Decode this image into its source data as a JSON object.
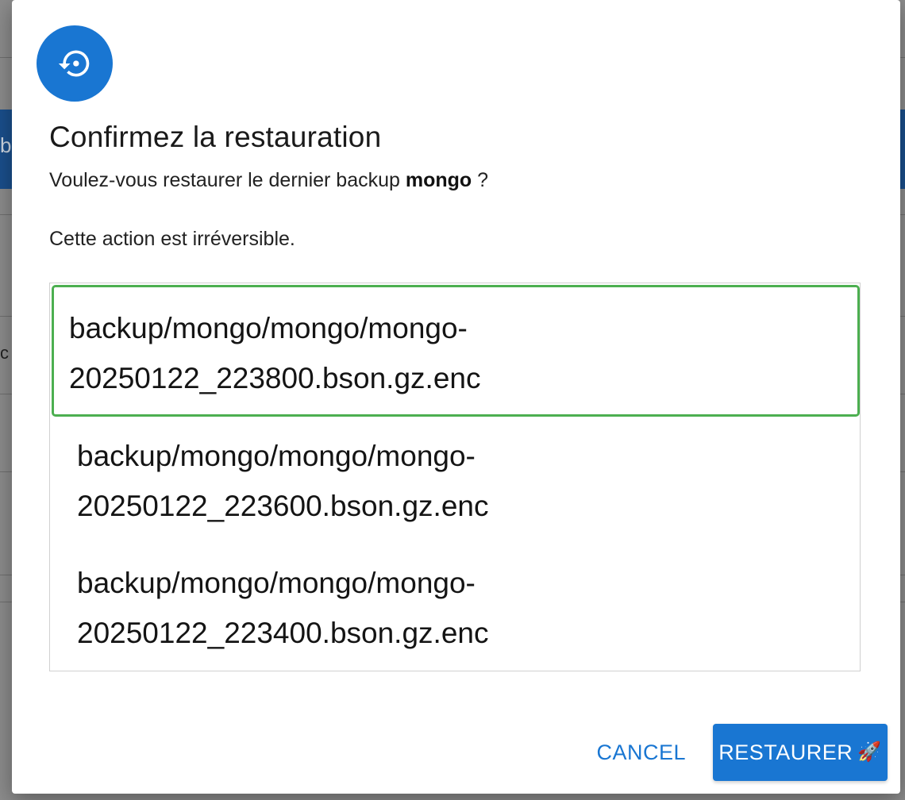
{
  "dialog": {
    "icon": "restore-icon",
    "title": "Confirmez la restauration",
    "question_prefix": "Voulez-vous restaurer le dernier backup",
    "backup_name": "mongo",
    "question_suffix": "?",
    "warning": "Cette action est irréversible."
  },
  "backups": [
    {
      "line1": "backup/mongo/mongo/mongo-",
      "line2": "20250122_223800.bson.gz.enc",
      "selected": true
    },
    {
      "line1": "backup/mongo/mongo/mongo-",
      "line2": "20250122_223600.bson.gz.enc",
      "selected": false
    },
    {
      "line1": "backup/mongo/mongo/mongo-",
      "line2": "20250122_223400.bson.gz.enc",
      "selected": false
    }
  ],
  "actions": {
    "cancel_label": "CANCEL",
    "confirm_label": "RESTAURER",
    "confirm_emoji": "🚀"
  },
  "background": {
    "fragment_1": "b",
    "fragment_2": "c"
  },
  "colors": {
    "primary": "#1976d2",
    "selected_border": "#4caf50"
  }
}
